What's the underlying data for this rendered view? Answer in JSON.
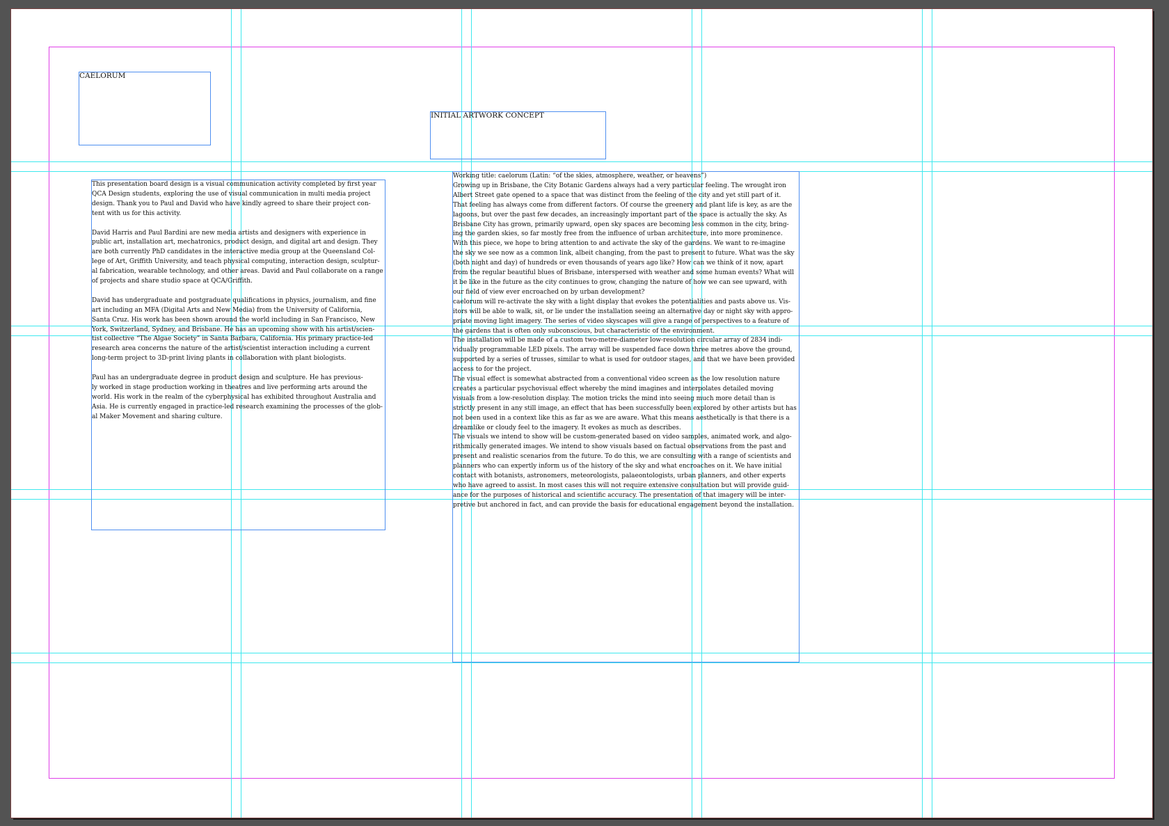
{
  "header_frames": {
    "caelorum": "CAELORUM",
    "concept": "INITIAL ARTWORK CONCEPT"
  },
  "left_text": {
    "paragraphs": [
      [
        "This presentation board design is a visual communication activity completed by first year",
        "QCA Design students, exploring the use of visual communication in multi media project",
        "design. Thank you to Paul and David who have kindly agreed to share their project con-",
        "tent with us for this activity."
      ],
      [
        "David Harris and Paul Bardini are new media artists and designers with experience in",
        "public art, installation art, mechatronics, product design, and digital art and design. They",
        "are both currently PhD candidates in the interactive media group at the Queensland Col-",
        "lege of Art, Griffith University, and teach physical computing, interaction design, sculptur-",
        "al fabrication, wearable technology, and other areas. David and Paul collaborate on a range",
        "of projects and share studio space at QCA/Griffith."
      ],
      [
        "David has undergraduate and postgraduate qualifications in physics, journalism, and fine",
        "art including an MFA (Digital Arts and New Media) from the University of California,",
        "Santa Cruz. His work has been shown around the world including in San Francisco, New",
        "York, Switzerland, Sydney, and Brisbane. He has an upcoming show with his artist/scien-",
        "tist collective “The Algae Society” in Santa Barbara, California. His primary practice-led",
        "research area concerns the nature of the artist/scientist interaction including a current",
        "long-term project to 3D-print living plants in collaboration with plant biologists."
      ],
      [
        "Paul has an undergraduate degree in product design and sculpture. He has previous-",
        "ly worked in stage production working in theatres and live performing arts around the",
        "world. His work in the realm of the cyberphysical has exhibited throughout Australia and",
        "Asia. He is currently engaged in practice-led research examining the processes of the glob-",
        "al Maker Movement and sharing culture."
      ]
    ]
  },
  "right_text": {
    "lines": [
      "Working title: caelorum (Latin: “of the skies, atmosphere, weather, or heavens”)",
      "Growing up in Brisbane, the City Botanic Gardens always had a very particular feeling. The wrought iron",
      "Albert Street gate opened to a space that was distinct from the feeling of the city and yet still part of it.",
      "That feeling has always come from different factors. Of course the greenery and plant life is key, as are the",
      "lagoons, but over the past few decades, an increasingly important part of the space is actually the sky. As",
      "Brisbane City has grown, primarily upward, open sky spaces are becoming less common in the city, bring-",
      "ing the garden skies, so far mostly free from the influence of urban architecture, into more prominence.",
      "With this piece, we hope to bring attention to and activate the sky of the gardens. We want to re-imagine",
      "the sky we see now as a common link, albeit changing, from the past to present to future. What was the sky",
      "(both night and day) of hundreds or even thousands of years ago like? How can we think of it now, apart",
      "from the regular beautiful blues of Brisbane, interspersed with weather and some human events? What will",
      "it be like in the future as the city continues to grow, changing the nature of how we can see upward, with",
      "our field of view ever encroached on by urban development?",
      "caelorum will re-activate the sky with a light display that evokes the potentialities and pasts above us. Vis-",
      "itors will be able to walk, sit, or lie under the installation seeing an alternative day or night sky with appro-",
      "priate moving light imagery. The series of video skyscapes will give a range of perspectives to a feature of",
      "the gardens that is often only subconscious, but characteristic of the environment.",
      "The installation will be made of a custom two-metre-diameter low-resolution circular array of 2834 indi-",
      "vidually programmable LED pixels. The array will be suspended face down three metres above the ground,",
      "supported by a series of trusses, similar to what is used for outdoor stages, and that we have been provided",
      "access to for the project.",
      "The visual effect is somewhat abstracted from a conventional video screen as the low resolution nature",
      "creates a particular psychovisual effect whereby the mind imagines and interpolates detailed moving",
      "visuals from a low-resolution display. The motion tricks the mind into seeing much more detail than is",
      "strictly present in any still image, an effect that has been successfully been explored by other artists but has",
      "not been used in a context like this as far as we are aware. What this means aesthetically is that there is a",
      "dreamlike or cloudy feel to the imagery. It evokes as much as describes.",
      "The visuals we intend to show will be custom-generated based on video samples, animated work, and algo-",
      "rithmically generated images. We intend to show visuals based on factual observations from the past and",
      "present and realistic scenarios from the future. To do this, we are consulting with a range of scientists and",
      "planners who can expertly inform us of the history of the sky and what encroaches on it. We have initial",
      "contact with botanists, astronomers, meteorologists, palaeontologists, urban planners, and other experts",
      "who have agreed to assist. In most cases this will not require extensive consultation but will provide guid-",
      "ance for the purposes of historical and scientific accuracy. The presentation of that imagery will be inter-",
      "pretive but anchored in fact, and can provide the basis for educational engagement beyond the installation."
    ]
  }
}
